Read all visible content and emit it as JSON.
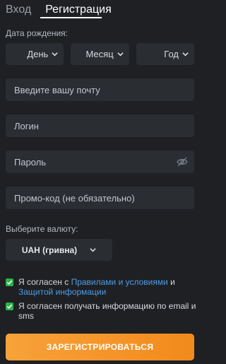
{
  "tabs": {
    "login": "Вход",
    "register": "Регистрация"
  },
  "dob": {
    "label": "Дата рождения:",
    "day": "День",
    "month": "Месяц",
    "year": "Год"
  },
  "fields": {
    "email_placeholder": "Введите вашу почту",
    "login_placeholder": "Логин",
    "password_placeholder": "Пароль",
    "promo_placeholder": "Промо-код (не обязательно)"
  },
  "currency": {
    "label": "Выберите валюту:",
    "selected": "UAH (гривна)"
  },
  "agreements": {
    "terms_prefix": "Я согласен с ",
    "terms_link": "Правилами и условиями",
    "terms_and": " и ",
    "privacy_link": "Защитой информации",
    "news_text": "Я согласен получать информацию по email и sms",
    "terms_checked": true,
    "news_checked": true
  },
  "submit_label": "ЗАРЕГИСТРИРОВАТЬСЯ",
  "colors": {
    "accent": "#f28a1d",
    "check": "#2fb24b",
    "link": "#4d9ce8"
  }
}
